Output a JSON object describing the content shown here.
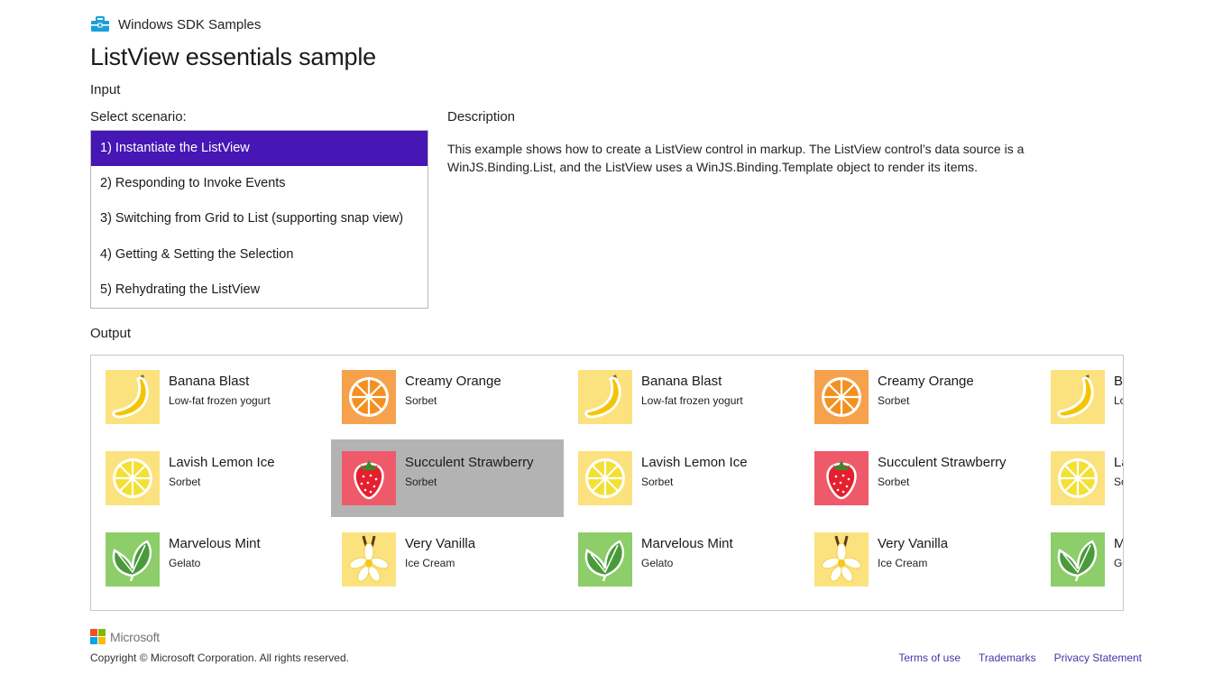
{
  "header": {
    "app_title": "Windows SDK Samples",
    "page_title": "ListView essentials sample"
  },
  "input": {
    "label": "Input",
    "select_label": "Select scenario:",
    "scenarios": [
      {
        "label": "1) Instantiate the ListView",
        "selected": true
      },
      {
        "label": "2) Responding to Invoke Events",
        "selected": false
      },
      {
        "label": "3) Switching from Grid to List (supporting snap view)",
        "selected": false
      },
      {
        "label": "4) Getting & Setting the Selection",
        "selected": false
      },
      {
        "label": "5) Rehydrating the ListView",
        "selected": false
      }
    ],
    "selected_color": "#4617b4"
  },
  "description": {
    "label": "Description",
    "text": "This example shows how to create a ListView control in markup. The ListView control’s data source is a WinJS.Binding.List, and the ListView uses a WinJS.Binding.Template object to render its items."
  },
  "output": {
    "label": "Output",
    "highlight_color": "#b3b3b3",
    "items": [
      {
        "name": "Banana Blast",
        "kind": "Low-fat frozen yogurt",
        "icon": "banana-icon"
      },
      {
        "name": "Lavish Lemon Ice",
        "kind": "Sorbet",
        "icon": "lemon-icon"
      },
      {
        "name": "Marvelous Mint",
        "kind": "Gelato",
        "icon": "mint-icon"
      },
      {
        "name": "Creamy Orange",
        "kind": "Sorbet",
        "icon": "orange-icon"
      },
      {
        "name": "Succulent Strawberry",
        "kind": "Sorbet",
        "icon": "strawberry-icon",
        "highlighted": true
      },
      {
        "name": "Very Vanilla",
        "kind": "Ice Cream",
        "icon": "vanilla-icon"
      },
      {
        "name": "Banana Blast",
        "kind": "Low-fat frozen yogurt",
        "icon": "banana-icon"
      },
      {
        "name": "Lavish Lemon Ice",
        "kind": "Sorbet",
        "icon": "lemon-icon"
      },
      {
        "name": "Marvelous Mint",
        "kind": "Gelato",
        "icon": "mint-icon"
      },
      {
        "name": "Creamy Orange",
        "kind": "Sorbet",
        "icon": "orange-icon"
      },
      {
        "name": "Succulent Strawberry",
        "kind": "Sorbet",
        "icon": "strawberry-icon"
      },
      {
        "name": "Very Vanilla",
        "kind": "Ice Cream",
        "icon": "vanilla-icon"
      },
      {
        "name": "Banana Blast",
        "kind": "Low-fat frozen yogurt",
        "icon": "banana-icon"
      },
      {
        "name": "Lavish Lemon Ice",
        "kind": "Sorbet",
        "icon": "lemon-icon"
      },
      {
        "name": "Marvelous Mint",
        "kind": "Gelato",
        "icon": "mint-icon"
      }
    ]
  },
  "footer": {
    "brand": "Microsoft",
    "copyright": "Copyright © Microsoft Corporation. All rights reserved.",
    "links": [
      "Terms of use",
      "Trademarks",
      "Privacy Statement"
    ],
    "logo_colors": [
      "#f25022",
      "#7fba00",
      "#00a4ef",
      "#ffb900"
    ]
  }
}
